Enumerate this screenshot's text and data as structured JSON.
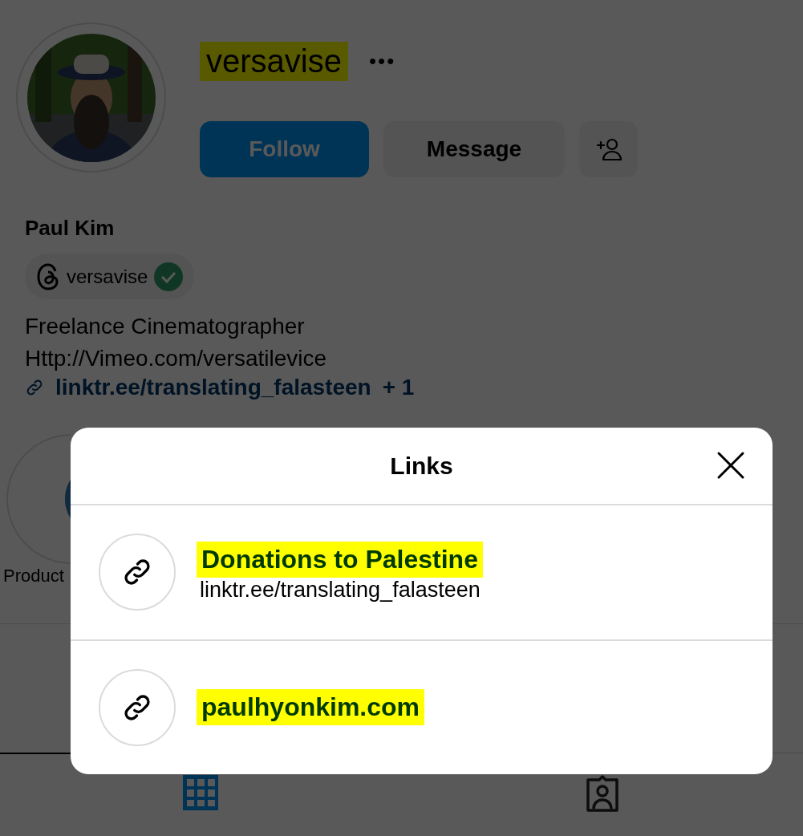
{
  "profile": {
    "username": "versavise",
    "username_highlighted": true,
    "more": "•••",
    "buttons": [
      {
        "kind": "primary",
        "label": "Follow"
      },
      {
        "kind": "secondary",
        "label": "Message"
      },
      {
        "kind": "icon"
      }
    ],
    "name": "Paul Kim",
    "threads": {
      "handle": "versavise",
      "verified": true
    },
    "bio": [
      "Freelance Cinematographer",
      "Http://Vimeo.com/versatilevice"
    ],
    "link": {
      "text": "linktr.ee/translating_falasteen",
      "extra": "+ 1"
    }
  },
  "highlights": [
    {
      "label": "Product"
    }
  ],
  "tabs": [
    {
      "kind": "grid",
      "selected": true
    },
    {
      "kind": "tagged",
      "selected": false
    }
  ],
  "modal": {
    "title": "Links",
    "links": [
      {
        "title": "Donations to Palestine",
        "url": "linktr.ee/translating_falasteen",
        "highlighted": true
      },
      {
        "title": "paulhyonkim.com",
        "highlighted": true
      }
    ]
  }
}
